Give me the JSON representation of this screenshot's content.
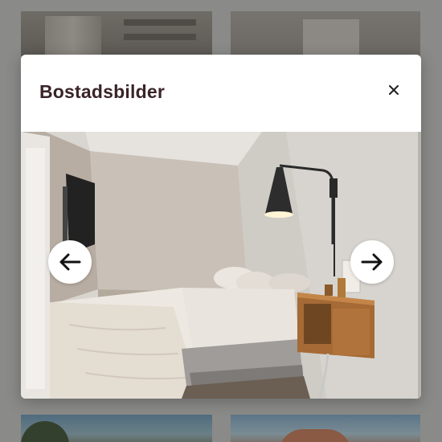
{
  "modal": {
    "title": "Bostadsbilder",
    "close_icon": "close-icon",
    "prev_icon": "arrow-left-icon",
    "next_icon": "arrow-right-icon"
  },
  "photo": {
    "subject": "bedroom"
  },
  "colors": {
    "title": "#3a2428",
    "overlay": "#8a8a88",
    "modal_bg": "#ffffff"
  }
}
